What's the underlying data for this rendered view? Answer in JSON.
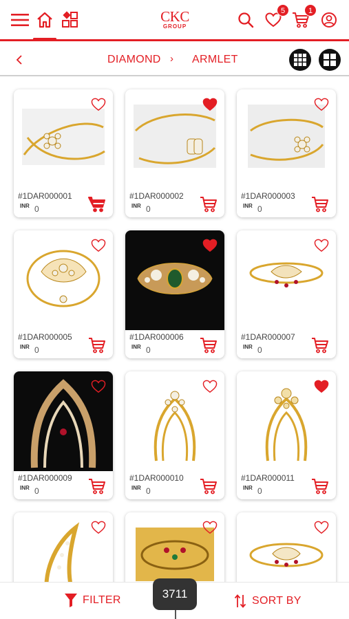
{
  "brand": {
    "logo_main": "CKC",
    "logo_sub": "GROUP"
  },
  "header": {
    "wishlist_count": "5",
    "cart_count": "1"
  },
  "breadcrumb": {
    "category": "DIAMOND",
    "separator": "›",
    "subcategory": "ARMLET"
  },
  "products": [
    {
      "code": "#1DAR000001",
      "currency": "INR",
      "price": "0",
      "wishlisted": false,
      "cart_filled": true
    },
    {
      "code": "#1DAR000002",
      "currency": "INR",
      "price": "0",
      "wishlisted": true,
      "cart_filled": false
    },
    {
      "code": "#1DAR000003",
      "currency": "INR",
      "price": "0",
      "wishlisted": false,
      "cart_filled": false
    },
    {
      "code": "#1DAR000005",
      "currency": "INR",
      "price": "0",
      "wishlisted": false,
      "cart_filled": false
    },
    {
      "code": "#1DAR000006",
      "currency": "INR",
      "price": "0",
      "wishlisted": true,
      "cart_filled": false
    },
    {
      "code": "#1DAR000007",
      "currency": "INR",
      "price": "0",
      "wishlisted": false,
      "cart_filled": false
    },
    {
      "code": "#1DAR000009",
      "currency": "INR",
      "price": "0",
      "wishlisted": false,
      "cart_filled": false
    },
    {
      "code": "#1DAR000010",
      "currency": "INR",
      "price": "0",
      "wishlisted": false,
      "cart_filled": false
    },
    {
      "code": "#1DAR000011",
      "currency": "INR",
      "price": "0",
      "wishlisted": true,
      "cart_filled": false
    },
    {
      "code": "",
      "currency": "",
      "price": "",
      "wishlisted": false,
      "cart_filled": false
    },
    {
      "code": "",
      "currency": "",
      "price": "",
      "wishlisted": false,
      "cart_filled": false
    },
    {
      "code": "",
      "currency": "",
      "price": "",
      "wishlisted": false,
      "cart_filled": false
    }
  ],
  "footer": {
    "filter_label": "FILTER",
    "sort_label": "SORT BY",
    "result_count": "3711"
  },
  "colors": {
    "accent": "#e31e24",
    "pill": "#333333"
  }
}
